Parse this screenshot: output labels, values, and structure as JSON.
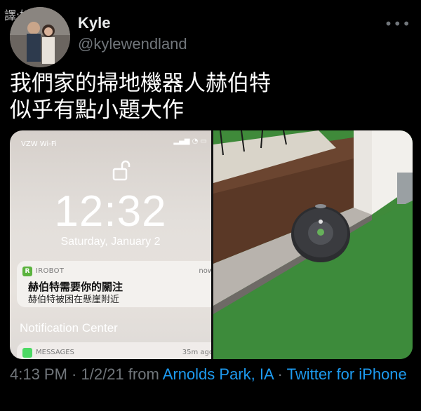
{
  "watermark": "譯:好色龍",
  "user": {
    "display_name": "Kyle",
    "handle": "@kylewendland"
  },
  "more_icon": "more-dots-icon",
  "tweet": {
    "line1": "我們家的掃地機器人赫伯特",
    "line2": "似乎有點小題大作"
  },
  "lockscreen": {
    "carrier": "VZW Wi-Fi",
    "time": "12:32",
    "date": "Saturday, January 2",
    "notification": {
      "app_name": "IROBOT",
      "age": "now",
      "title": "赫伯特需要你的關注",
      "body": "赫伯特被困在懸崖附近"
    },
    "notification_center_label": "Notification Center",
    "messages": {
      "app_name": "MESSAGES",
      "age": "35m ago"
    }
  },
  "meta": {
    "time": "4:13 PM",
    "sep1": " · ",
    "date": "1/2/21",
    "from_text": " from ",
    "location": "Arnolds Park, IA",
    "sep2": " · ",
    "source": "Twitter for iPhone"
  },
  "colors": {
    "link": "#1d9bf0",
    "muted": "#71767b",
    "background": "#000000"
  }
}
